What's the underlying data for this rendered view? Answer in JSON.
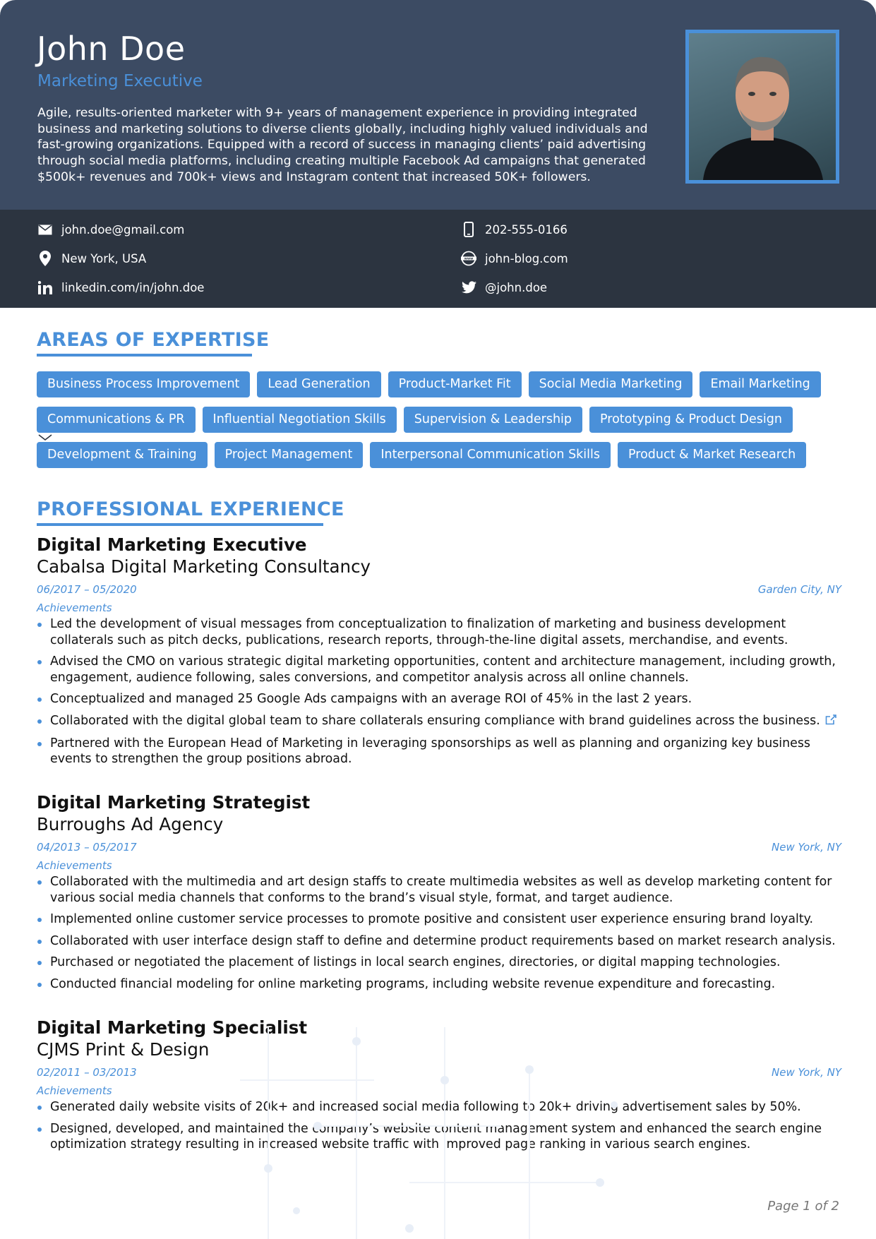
{
  "header": {
    "name": "John Doe",
    "title": "Marketing Executive",
    "summary": "Agile, results-oriented marketer with 9+ years of management experience in providing integrated business and marketing solutions to diverse clients globally, including highly valued individuals and fast-growing organizations. Equipped with a record of success in managing clients’ paid advertising through social media platforms, including creating multiple Facebook Ad campaigns that generated $500k+ revenues and 700k+ views and Instagram content that increased 50K+ followers."
  },
  "contacts": {
    "email": "john.doe@gmail.com",
    "phone": "202-555-0166",
    "location": "New York, USA",
    "website": "john-blog.com",
    "linkedin": "linkedin.com/in/john.doe",
    "twitter": "@john.doe"
  },
  "expertise": {
    "heading": "AREAS OF EXPERTISE",
    "rows": [
      [
        "Business Process Improvement",
        "Lead Generation",
        "Product-Market Fit",
        "Social Media Marketing",
        "Email Marketing"
      ],
      [
        "Communications & PR",
        "Influential Negotiation Skills",
        "Supervision & Leadership",
        "Prototyping & Product Design"
      ],
      [
        "Development & Training",
        "Project Management",
        "Interpersonal Communication Skills",
        "Product & Market Research"
      ]
    ]
  },
  "experience": {
    "heading": "PROFESSIONAL EXPERIENCE",
    "jobs": [
      {
        "title": "Digital Marketing Executive",
        "company": "Cabalsa Digital Marketing Consultancy",
        "dates": "06/2017 – 05/2020",
        "location": "Garden City, NY",
        "achievements_label": "Achievements",
        "bullets": [
          "Led the development of visual messages from conceptualization to finalization of marketing and business development collaterals such as pitch decks, publications, research reports, through-the-line digital assets, merchandise, and events.",
          "Advised the CMO on various strategic digital marketing opportunities, content and architecture management, including growth, engagement, audience following, sales conversions, and competitor analysis across all online channels.",
          "Conceptualized and managed 25 Google Ads campaigns with an average ROI of 45% in the last 2 years.",
          "Collaborated with the digital global team to share collaterals ensuring compliance with brand guidelines across the business.",
          "Partnered with the European Head of Marketing in leveraging sponsorships as well as planning and organizing key business events to strengthen the group positions abroad."
        ]
      },
      {
        "title": "Digital Marketing Strategist",
        "company": "Burroughs Ad Agency",
        "dates": "04/2013 – 05/2017",
        "location": "New York, NY",
        "achievements_label": "Achievements",
        "bullets": [
          "Collaborated with the multimedia and art design staffs to create multimedia websites as well as develop marketing content for various social media channels that conforms to the brand’s visual style, format, and target audience.",
          "Implemented online customer service processes to promote positive and consistent user experience ensuring brand loyalty.",
          "Collaborated with user interface design staff to define and determine product requirements based on market research analysis.",
          "Purchased or negotiated the placement of listings in local search engines, directories, or digital mapping technologies.",
          "Conducted financial modeling for online marketing programs, including website revenue expenditure and forecasting."
        ]
      },
      {
        "title": "Digital Marketing Specialist",
        "company": "CJMS Print & Design",
        "dates": "02/2011 – 03/2013",
        "location": "New York, NY",
        "achievements_label": "Achievements",
        "bullets": [
          "Generated daily website visits of 20k+ and increased social media following to 20k+ driving advertisement sales by 50%.",
          "Designed, developed, and maintained the company’s website content management system and enhanced the search engine optimization strategy resulting in increased website traffic with improved page ranking in various search engines."
        ]
      }
    ]
  },
  "footer": {
    "page": "Page 1 of 2"
  },
  "colors": {
    "header_bg": "#3c4b63",
    "contacts_bg": "#2c3440",
    "accent": "#4a90d9"
  }
}
